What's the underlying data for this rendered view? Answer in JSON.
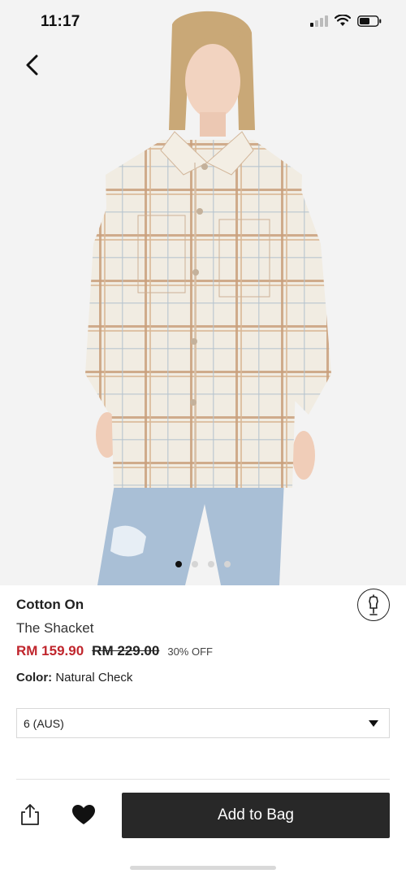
{
  "status_bar": {
    "time": "11:17"
  },
  "product": {
    "brand": "Cotton On",
    "name": "The Shacket",
    "price_now": "RM 159.90",
    "price_was": "RM 229.00",
    "discount": "30% OFF",
    "color_label": "Color:",
    "color_value": "Natural Check"
  },
  "gallery": {
    "image_count": 4,
    "active_index": 0
  },
  "size_select": {
    "value": "6 (AUS)"
  },
  "actions": {
    "add_to_bag": "Add to Bag"
  },
  "colors": {
    "price_sale": "#c0262d",
    "button_bg": "#282828",
    "check_base": "#f1ece2",
    "check_stripe": "#c69d78",
    "denim": "#a9bfd6"
  },
  "icons": {
    "back": "chevron-left-icon",
    "share": "share-icon",
    "wishlist": "heart-icon",
    "size_guide": "mannequin-icon",
    "dropdown": "triangle-down-icon"
  }
}
